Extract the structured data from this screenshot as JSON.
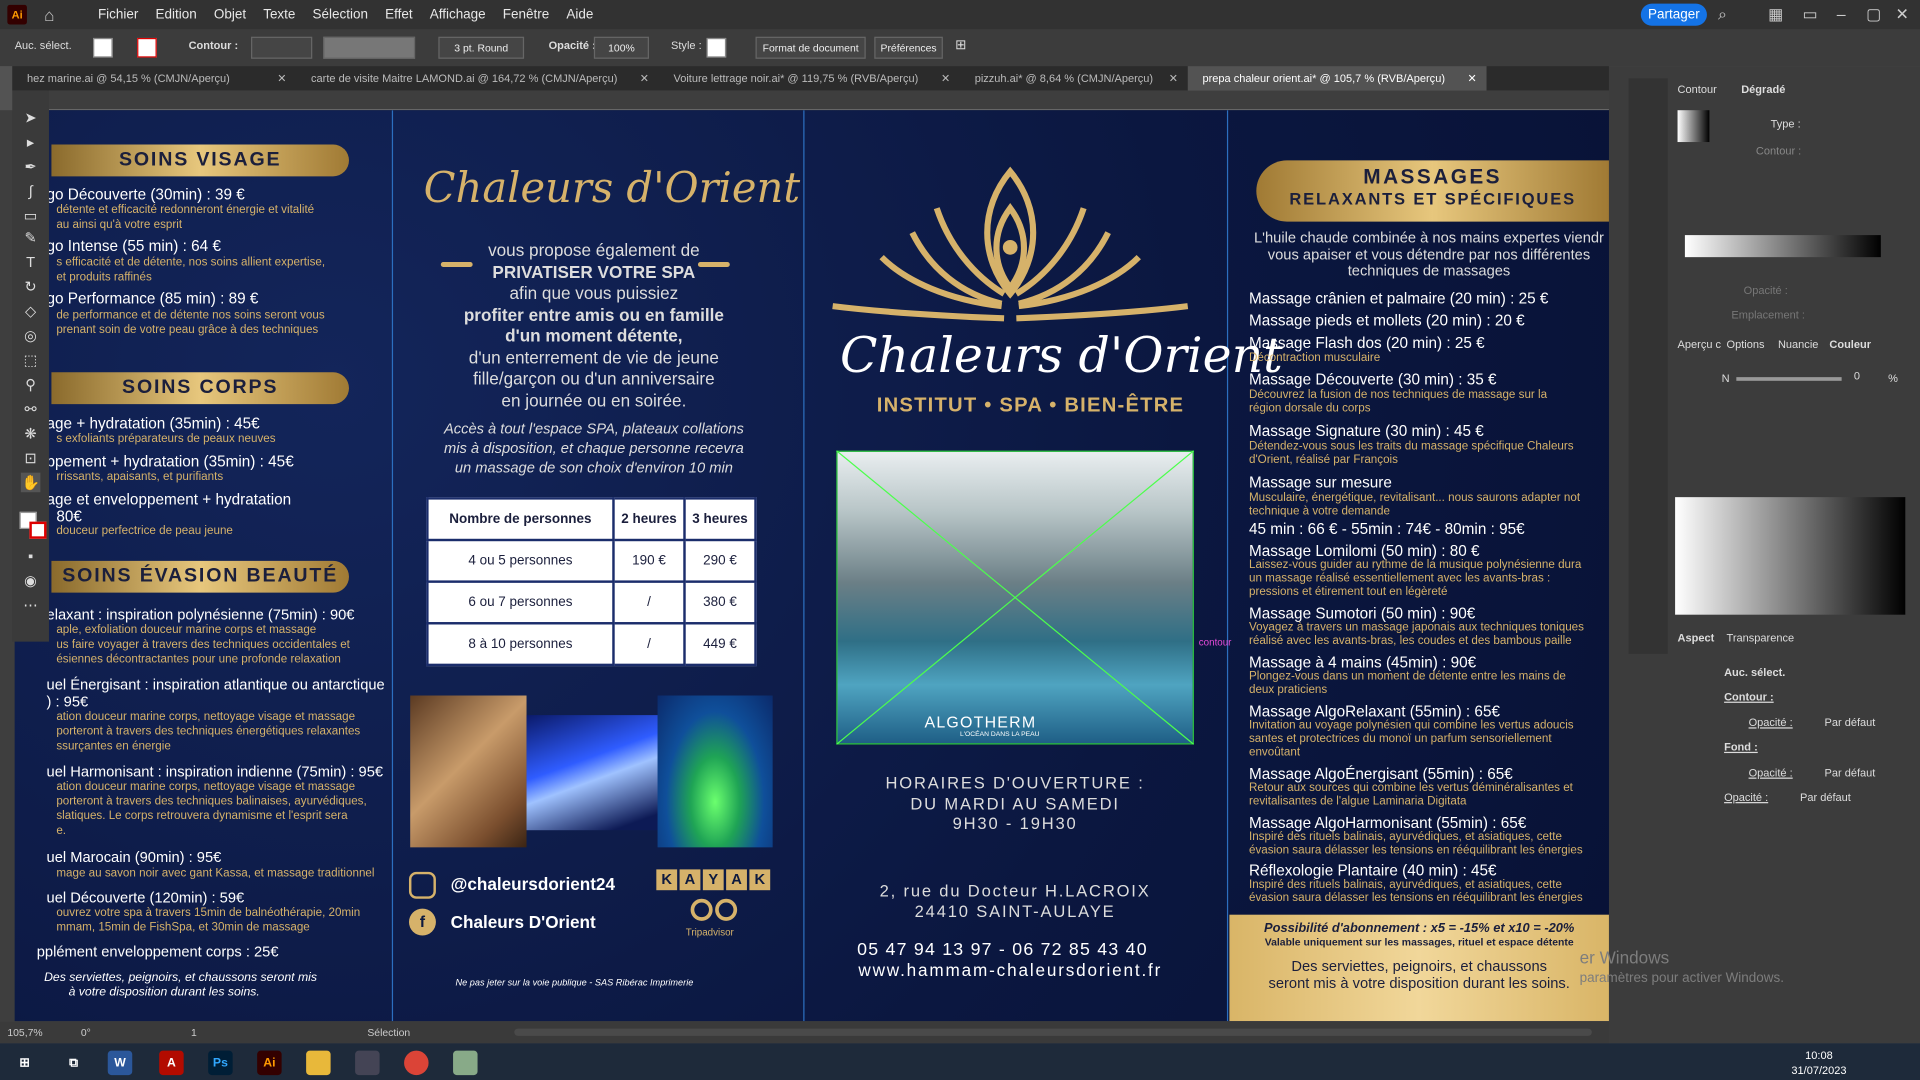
{
  "app": {
    "logo": "Ai",
    "menu": [
      "Fichier",
      "Edition",
      "Objet",
      "Texte",
      "Sélection",
      "Effet",
      "Affichage",
      "Fenêtre",
      "Aide"
    ],
    "share": "Partager"
  },
  "control": {
    "selection": "Auc. sélect.",
    "contour": "Contour :",
    "stroke": "3 pt. Round",
    "opacity_label": "Opacité :",
    "opacity": "100%",
    "style": "Style :",
    "doc_format": "Format de document",
    "prefs": "Préférences"
  },
  "tabs": [
    {
      "label": "hez marine.ai @ 54,15 % (CMJN/Aperçu)"
    },
    {
      "label": "carte de visite Maitre LAMOND.ai @ 164,72 % (CMJN/Aperçu)"
    },
    {
      "label": "Voiture lettrage noir.ai* @ 119,75 % (RVB/Aperçu)"
    },
    {
      "label": "pizzuh.ai* @ 8,64 % (CMJN/Aperçu)"
    },
    {
      "label": "prepa chaleur orient.ai* @ 105,7 % (RVB/Aperçu)"
    }
  ],
  "brochure": {
    "p1": {
      "visage": "SOINS VISAGE",
      "v": [
        [
          "go Découverte (30min) : 39 €",
          "détente et efficacité redonneront énergie et vitalité",
          "au ainsi qu'à votre esprit"
        ],
        [
          "go Intense (55 min) : 64 €",
          "s efficacité et de détente, nos soins allient expertise,",
          "et produits raffinés"
        ],
        [
          "go Performance (85 min) : 89 €",
          "de performance et de détente nos soins seront vous",
          "prenant soin de votre peau grâce à des techniques"
        ]
      ],
      "corps": "SOINS CORPS",
      "c": [
        [
          "age + hydratation (35min) : 45€",
          "s exfoliants préparateurs de peaux neuves"
        ],
        [
          "ppement + hydratation (35min) : 45€",
          "rrissants, apaisants, et purifiants"
        ],
        [
          "age et enveloppement + hydratation",
          "80€",
          "douceur perfectrice de peau jeune"
        ]
      ],
      "evasion": "SOINS ÉVASION BEAUTÉ",
      "e": [
        [
          "elaxant : inspiration polynésienne (75min) : 90€",
          "aple, exfoliation douceur marine corps et massage",
          "us faire voyager à travers des techniques occidentales et",
          "ésiennes décontractantes pour une profonde relaxation"
        ],
        [
          "uel Énergisant : inspiration atlantique ou antarctique",
          ") : 95€",
          "ation douceur marine corps, nettoyage visage et massage",
          "porteront à travers des techniques énergétiques relaxantes",
          "ssurçantes en énergie"
        ],
        [
          "uel Harmonisant : inspiration indienne (75min) : 95€",
          "ation douceur marine corps, nettoyage visage et massage",
          "porteront à travers des techniques balinaises, ayurvédiques,",
          "slatiques. Le corps retrouvera dynamisme et l'esprit sera",
          "e."
        ],
        [
          "uel Marocain (90min) : 95€",
          "mage au savon noir avec gant Kassa, et massage traditionnel"
        ],
        [
          "uel Découverte (120min) : 59€",
          "ouvrez votre spa à travers 15min de balnéothérapie, 20min",
          "mmam, 15min de FishSpa, et 30min de massage"
        ],
        [
          "pplément enveloppement corps : 25€"
        ]
      ],
      "footer": [
        "Des serviettes, peignoirs, et chaussons seront mis",
        "à votre disposition durant les soins."
      ]
    },
    "p2": {
      "script": "Chaleurs d'Orient",
      "lines": [
        "vous propose également de",
        "PRIVATISER VOTRE SPA",
        "afin que vous puissiez",
        "profiter entre amis ou en famille",
        "d'un moment détente,",
        "d'un enterrement de vie de jeune",
        "fille/garçon ou d'un anniversaire",
        "en journée ou en soirée."
      ],
      "access": [
        "Accès à tout l'espace SPA, plateaux collations",
        "mis à disposition, et chaque personne recevra",
        "un massage de son choix d'environ 10 min"
      ],
      "table": {
        "headers": [
          "Nombre de personnes",
          "2 heures",
          "3 heures"
        ],
        "rows": [
          [
            "4 ou 5 personnes",
            "190 €",
            "290 €"
          ],
          [
            "6 ou 7 personnes",
            "/",
            "380 €"
          ],
          [
            "8 à 10 personnes",
            "/",
            "449 €"
          ]
        ]
      },
      "instagram": "@chaleursdorient24",
      "facebook": "Chaleurs D'Orient",
      "kayak": [
        "K",
        "A",
        "Y",
        "A",
        "K"
      ],
      "tripadvisor": "Tripadvisor",
      "footer": "Ne pas jeter sur la voie publique  -  SAS Ribérac Imprimerie"
    },
    "p3": {
      "script": "Chaleurs d'Orient",
      "tagline": "INSTITUT • SPA • BIEN-ÊTRE",
      "brand": "ALGOTHERM",
      "brand_sub": "L'OCÉAN DANS LA PEAU",
      "contour_tag": "contour",
      "hours": [
        "HORAIRES D'OUVERTURE :",
        "DU MARDI AU SAMEDI",
        "9H30 - 19H30"
      ],
      "address": [
        "2, rue du Docteur H.LACROIX",
        "24410 SAINT-AULAYE"
      ],
      "phone": "05 47 94 13 97 - 06 72 85 43 40",
      "web": "www.hammam-chaleursdorient.fr"
    },
    "p4": {
      "title1": "MASSAGES",
      "title2": "RELAXANTS ET SPÉCIFIQUES",
      "intro": [
        "L'huile chaude combinée à nos mains expertes viendr",
        "vous apaiser et vous détendre par nos différentes",
        "techniques de massages"
      ],
      "items": [
        [
          "Massage crânien et palmaire (20 min) : 25 €"
        ],
        [
          "Massage pieds et mollets (20 min) : 20 €"
        ],
        [
          "Massage Flash dos (20 min) : 25 €",
          "Décontraction musculaire"
        ],
        [
          "Massage Découverte (30 min) : 35 €",
          "Découvrez la fusion de nos techniques de massage sur la",
          "région dorsale du corps"
        ],
        [
          "Massage Signature (30 min) : 45 €",
          "Détendez-vous sous les traits du massage spécifique Chaleurs",
          "d'Orient, réalisé par François"
        ],
        [
          "Massage sur mesure",
          "Musculaire, énergétique, revitalisant... nous saurons adapter not",
          "technique à votre demande"
        ],
        [
          "45 min : 66 €  -  55min : 74€  -  80min : 95€"
        ],
        [
          "Massage Lomilomi (50 min) : 80 €",
          "Laissez-vous guider au rythme de la musique polynésienne dura",
          "un massage réalisé essentiellement avec les avants-bras :",
          "pressions et étirement tout en légèreté"
        ],
        [
          "Massage Sumotori (50 min) : 90€",
          "Voyagez à travers un massage japonais aux techniques toniques",
          "réalisé avec les avants-bras, les coudes et des bambous paille"
        ],
        [
          "Massage à 4 mains (45min) : 90€",
          "Plongez-vous dans un moment de détente entre les mains de",
          "deux praticiens"
        ],
        [
          "Massage AlgoRelaxant (55min) : 65€",
          "Invitation au voyage polynésien qui combine les vertus adoucis",
          "santes et protectrices du monoï un parfum sensoriellement",
          "envoûtant"
        ],
        [
          "Massage AlgoÉnergisant (55min) : 65€",
          "Retour aux sources qui combine les vertus déminéralisantes et",
          "revitalisantes de l'algue Laminaria Digitata"
        ],
        [
          "Massage AlgoHarmonisant (55min) : 65€",
          "Inspiré des rituels balinais, ayurvédiques, et asiatiques, cette",
          "évasion saura délasser les tensions en rééquilibrant les énergies"
        ],
        [
          "Réflexologie Plantaire (40 min) : 45€",
          "Inspiré des rituels balinais, ayurvédiques, et asiatiques, cette",
          "évasion saura délasser les tensions en rééquilibrant les énergies"
        ]
      ],
      "sub_title": "Possibilité d'abonnement :  x5 = -15%  et x10 = -20%",
      "sub_note": "Valable uniquement sur les massages, rituel et espace détente",
      "sub_footer": [
        "Des serviettes, peignoirs, et chaussons",
        "seront mis à votre disposition durant les soins."
      ]
    }
  },
  "status": {
    "zoom": "105,7%",
    "angle": "0°",
    "page": "1",
    "mode": "Sélection"
  },
  "panels": {
    "tab_contour": "Contour",
    "tab_degrade": "Dégradé",
    "type": "Type :",
    "contour": "Contour :",
    "opacite": "Opacité :",
    "emplacement": "Emplacement :",
    "tabs2": [
      "Aperçu c",
      "Options",
      "Nuancie",
      "Couleur"
    ],
    "n_label": "N",
    "n_value": "0",
    "pct": "%",
    "aspect": "Aspect",
    "transparence": "Transparence",
    "rows": [
      {
        "label": "Auc. sélect.",
        "value": ""
      },
      {
        "label": "Contour :",
        "value": ""
      },
      {
        "label": "Opacité :",
        "value": "Par défaut"
      },
      {
        "label": "Fond :",
        "value": ""
      },
      {
        "label": "Opacité :",
        "value": "Par défaut"
      },
      {
        "label": "Opacité :",
        "value": "Par défaut"
      }
    ]
  },
  "watermark": [
    "er Windows",
    "paramètres pour activer Windows."
  ],
  "taskbar": {
    "time": "10:08",
    "date": "31/07/2023"
  }
}
